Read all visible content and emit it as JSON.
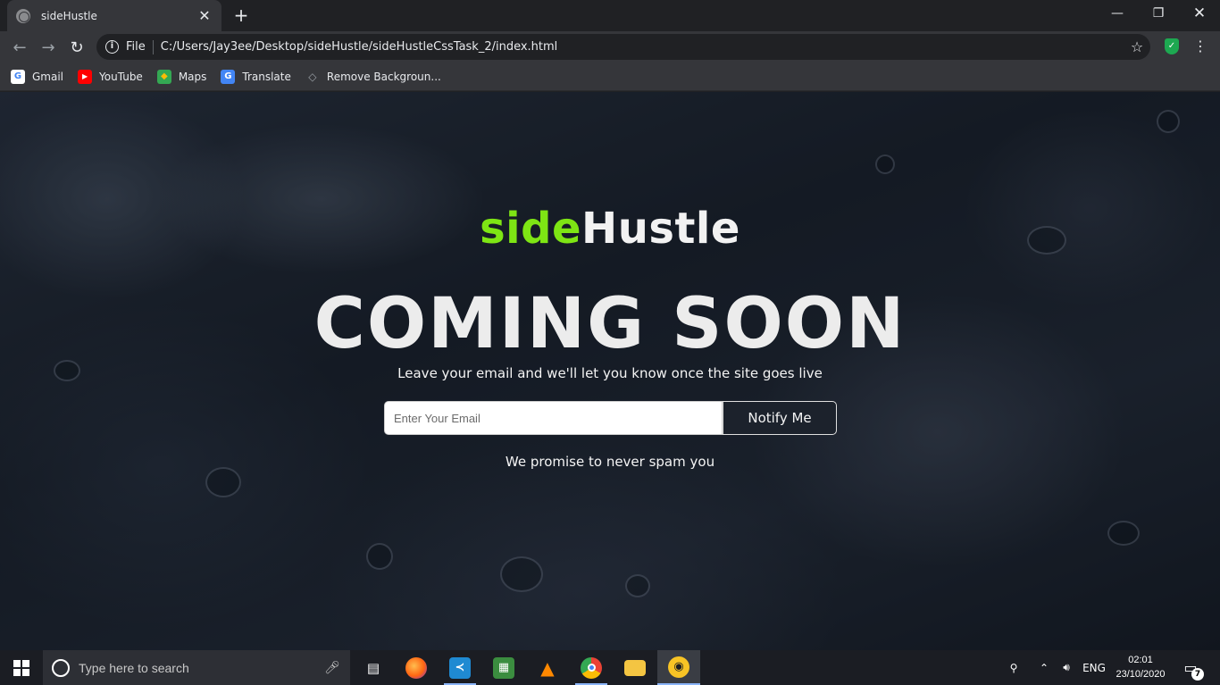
{
  "browser": {
    "tab_title": "sideHustle",
    "tab_close": "✕",
    "new_tab": "+",
    "address_scheme": "File",
    "address_url": "C:/Users/Jay3ee/Desktop/sideHustle/sideHustleCssTask_2/index.html",
    "bookmarks": [
      {
        "label": "Gmail",
        "icon": "G",
        "color": "#ffffff",
        "text_color": "#4285f4"
      },
      {
        "label": "YouTube",
        "icon": "▶",
        "color": "#ff0000",
        "text_color": "#ffffff"
      },
      {
        "label": "Maps",
        "icon": "◆",
        "color": "#34a853",
        "text_color": "#fbbc05"
      },
      {
        "label": "Translate",
        "icon": "G",
        "color": "#4285f4",
        "text_color": "#ffffff"
      },
      {
        "label": "Remove Backgroun...",
        "icon": "◇",
        "color": "#9aa0a6",
        "text_color": "#ffffff"
      }
    ]
  },
  "page": {
    "brand_accent": "side",
    "brand_rest": "Hustle",
    "headline": "COMING SOON",
    "subline": "Leave your email and we'll let you know once the site goes live",
    "email_placeholder": "Enter Your Email",
    "notify_label": "Notify Me",
    "promise": "We promise to never spam you",
    "accent_color": "#7ee514"
  },
  "taskbar": {
    "search_placeholder": "Type here to search",
    "language": "ENG",
    "time": "02:01",
    "date": "23/10/2020",
    "notification_count": "7"
  }
}
